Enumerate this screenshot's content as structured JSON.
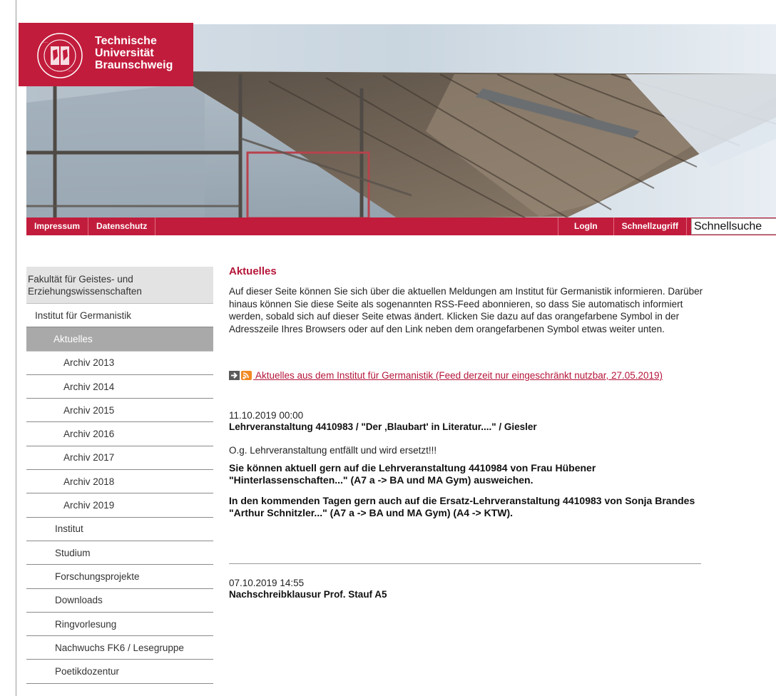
{
  "logo": {
    "line1": "Technische",
    "line2": "Universität",
    "line3": "Braunschweig",
    "seal_text": "CAROLO-WILHELMINA BRAUNSCHWEIG",
    "color": "#c21c3c"
  },
  "nav": {
    "impressum": "Impressum",
    "datenschutz": "Datenschutz",
    "login": "LogIn",
    "schnellzugriff": "Schnellzugriff",
    "search_value": "Schnellsuche"
  },
  "sidebar": {
    "faculty": "Fakultät für Geistes- und Erziehungswissenschaften",
    "institute": "Institut für Germanistik",
    "active": "Aktuelles",
    "archives": [
      "Archiv 2013",
      "Archiv 2014",
      "Archiv 2015",
      "Archiv 2016",
      "Archiv 2017",
      "Archiv 2018",
      "Archiv 2019"
    ],
    "sections": [
      "Institut",
      "Studium",
      "Forschungsprojekte",
      "Downloads",
      "Ringvorlesung",
      "Nachwuchs FK6 / Lesegruppe",
      "Poetikdozentur"
    ]
  },
  "main": {
    "title": "Aktuelles",
    "intro": "Auf dieser Seite können Sie sich über die aktuellen Meldungen am Institut für Germanistik informieren. Darüber hinaus können Sie diese Seite als sogenannten RSS-Feed abonnieren, so dass Sie automatisch informiert werden, sobald sich auf dieser Seite etwas ändert. Klicken Sie dazu auf das orangefarbene Symbol in der Adresszeile Ihres Browsers oder auf den Link neben dem orangefarbenen Symbol etwas weiter unten.",
    "feed_link": " Aktuelles aus dem Institut für Germanistik (Feed derzeit nur eingeschränkt nutzbar, 27.05.2019)",
    "entries": [
      {
        "date": "11.10.2019 00:00",
        "title": "Lehrveranstaltung 4410983 / \"Der ‚Blaubart' in Literatur....\" / Giesler",
        "text": "O.g. Lehrveranstaltung entfällt und wird ersetzt!!!",
        "bold1": "Sie können aktuell gern auf die Lehrveranstaltung 4410984 von Frau Hübener \"Hinterlassenschaften...\" (A7 a -> BA und MA Gym) ausweichen.",
        "bold2": "In den kommenden Tagen gern auch auf die Ersatz-Lehrveranstaltung 4410983 von Sonja Brandes \"Arthur Schnitzler...\" (A7 a -> BA und MA Gym) (A4 -> KTW)."
      },
      {
        "date": "07.10.2019 14:55",
        "title": "Nachschreibklausur Prof. Stauf A5"
      }
    ]
  }
}
